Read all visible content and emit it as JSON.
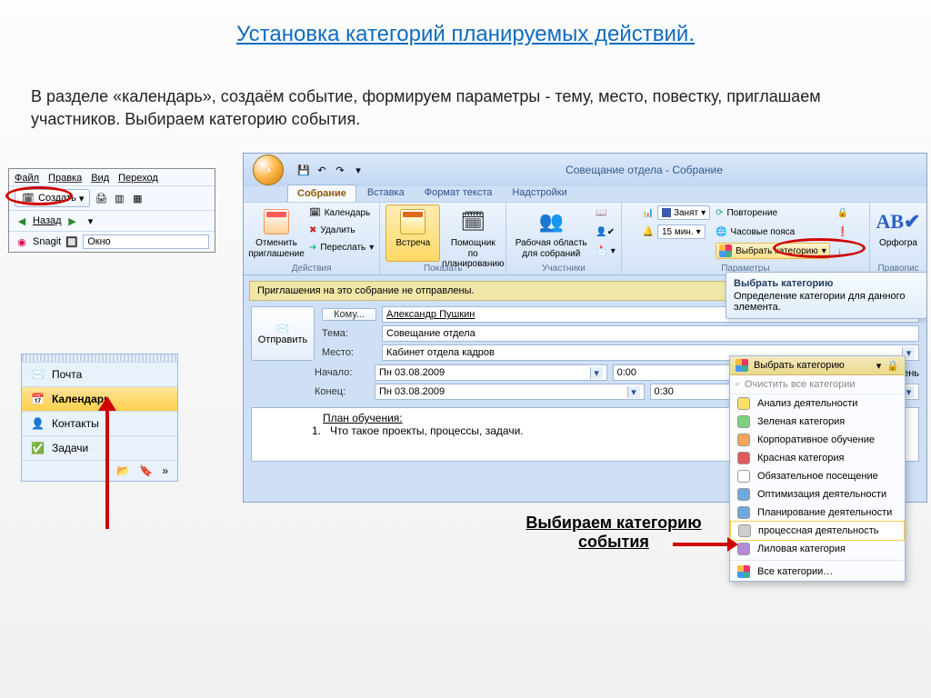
{
  "slide": {
    "title": "Установка категорий планируемых действий.",
    "body": "В разделе «календарь», создаём событие, формируем параметры  - тему, место, повестку, приглашаем участников. Выбираем категорию события.",
    "annotation": "Выбираем категорию события"
  },
  "nav_panel": {
    "menus": {
      "file": "Файл",
      "edit": "Правка",
      "view": "Вид",
      "go": "Переход"
    },
    "create": "Создать",
    "back": "Назад",
    "snagit": "Snagit",
    "window_field": "Окно"
  },
  "outlook_nav": {
    "mail": "Почта",
    "calendar": "Календарь",
    "contacts": "Контакты",
    "tasks": "Задачи"
  },
  "window": {
    "doc_title": "Совещание отдела - Собрание",
    "tabs": {
      "meeting": "Собрание",
      "insert": "Вставка",
      "format": "Формат текста",
      "addins": "Надстройки"
    },
    "groups": {
      "actions": "Действия",
      "show": "Показать",
      "attendees": "Участники",
      "options": "Параметры",
      "proof": "Правопис"
    },
    "buttons": {
      "cancel_invite_line1": "Отменить",
      "cancel_invite_line2": "приглашение",
      "calendar": "Календарь",
      "delete": "Удалить",
      "forward": "Переслать",
      "appointment": "Встреча",
      "scheduling_line1": "Помощник по",
      "scheduling_line2": "планированию",
      "workspace_line1": "Рабочая область",
      "workspace_line2": "для собраний",
      "busy": "Занят",
      "reminder_value": "15 мин.",
      "recurrence": "Повторение",
      "timezones": "Часовые пояса",
      "select_category": "Выбрать категорию",
      "spelling": "Орфогра"
    },
    "info_bar": "Приглашения на это собрание не отправлены.",
    "form": {
      "send": "Отправить",
      "to_label": "Кому...",
      "to_value": "Александр Пушкин",
      "subject_label": "Тема:",
      "subject_value": "Совещание отдела",
      "location_label": "Место:",
      "location_value": "Кабинет отдела кадров",
      "start_label": "Начало:",
      "end_label": "Конец:",
      "date_value": "Пн 03.08.2009",
      "start_time": "0:00",
      "end_time": "0:30",
      "all_day": "Целый день"
    },
    "body": {
      "heading": "План обучения:",
      "item1_num": "1.",
      "item1_text": "Что такое проекты, процессы, задачи."
    },
    "cat_tooltip": {
      "title": "Выбрать категорию",
      "desc": "Определение категории для данного элемента."
    }
  },
  "cat_dropdown": {
    "top_label": "Выбрать категорию",
    "clear": "Очистить все категории",
    "items": [
      {
        "label": "Анализ деятельности",
        "color": "#ffe066"
      },
      {
        "label": "Зеленая категория",
        "color": "#7bd07b"
      },
      {
        "label": "Корпоративное обучение",
        "color": "#f5a55a"
      },
      {
        "label": "Красная категория",
        "color": "#e05a5a"
      },
      {
        "label": "Обязательное посещение",
        "color": "#ffffff"
      },
      {
        "label": "Оптимизация деятельности",
        "color": "#6fa8dc"
      },
      {
        "label": "Планирование деятельности",
        "color": "#6fa8dc"
      },
      {
        "label": "процессная деятельность",
        "color": "#cfcfcf"
      },
      {
        "label": "Лиловая категория",
        "color": "#b48ad6"
      }
    ],
    "all": "Все категории…"
  },
  "colors": {
    "red": "#d00000",
    "accent": "#2d5289"
  }
}
